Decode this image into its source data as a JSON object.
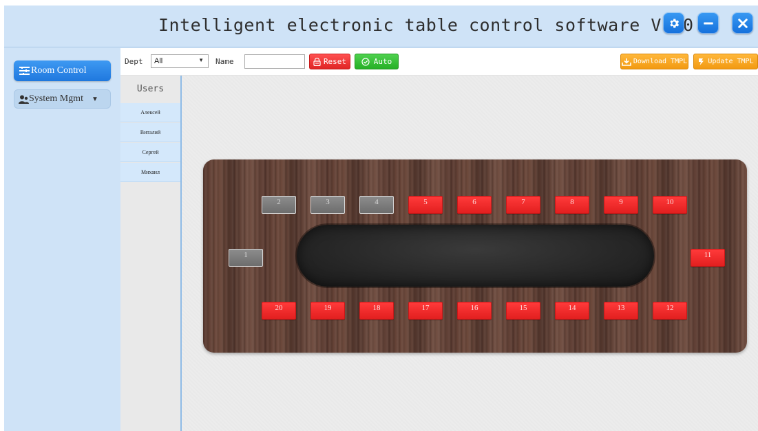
{
  "window": {
    "title": "Intelligent electronic table control software V1.0",
    "buttons": [
      {
        "name": "settings",
        "icon": "gear-icon"
      },
      {
        "name": "minimize",
        "icon": "minus-icon"
      },
      {
        "name": "close",
        "icon": "close-icon"
      }
    ]
  },
  "sidebar": {
    "items": [
      {
        "label": "Room Control",
        "icon": "menu-lines-icon",
        "active": true
      },
      {
        "label": "System Mgmt",
        "icon": "user-group-icon",
        "active": false,
        "expandable": true
      }
    ]
  },
  "toolbar": {
    "dept_label": "Dept",
    "dept_value": "All",
    "name_label": "Name",
    "name_value": "",
    "reset_label": "Reset",
    "auto_label": "Auto",
    "download_label": "Download TMPL",
    "update_label": "Update TMPL"
  },
  "users": {
    "header": "Users",
    "list": [
      "Алексей",
      "Виталий",
      "Сергей",
      "Михаил"
    ]
  },
  "seats": [
    {
      "id": "1",
      "state": "off"
    },
    {
      "id": "2",
      "state": "off"
    },
    {
      "id": "3",
      "state": "off"
    },
    {
      "id": "4",
      "state": "off"
    },
    {
      "id": "5",
      "state": "on"
    },
    {
      "id": "6",
      "state": "on"
    },
    {
      "id": "7",
      "state": "on"
    },
    {
      "id": "8",
      "state": "on"
    },
    {
      "id": "9",
      "state": "on"
    },
    {
      "id": "10",
      "state": "on"
    },
    {
      "id": "11",
      "state": "on"
    },
    {
      "id": "12",
      "state": "on"
    },
    {
      "id": "13",
      "state": "on"
    },
    {
      "id": "14",
      "state": "on"
    },
    {
      "id": "15",
      "state": "on"
    },
    {
      "id": "16",
      "state": "on"
    },
    {
      "id": "17",
      "state": "on"
    },
    {
      "id": "18",
      "state": "on"
    },
    {
      "id": "19",
      "state": "on"
    },
    {
      "id": "20",
      "state": "on"
    }
  ],
  "colors": {
    "accent_blue": "#1f78de",
    "seat_on": "#e21f1f",
    "seat_off": "#7a7a7a",
    "reset": "#e02525",
    "auto": "#26b026",
    "template_buttons": "#f29a12",
    "panel_bg": "#cfe3f7"
  }
}
